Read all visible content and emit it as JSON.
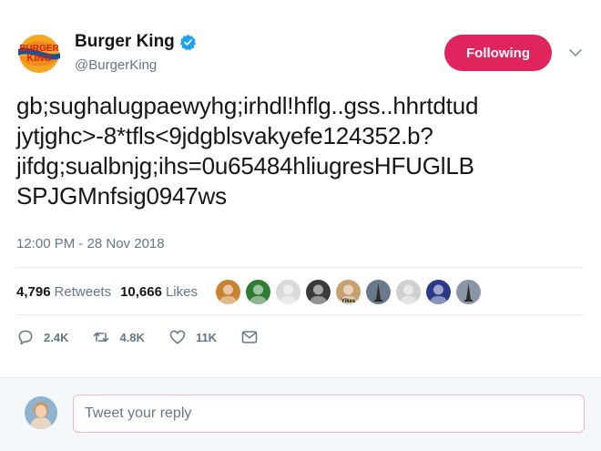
{
  "tweet": {
    "author": {
      "display_name": "Burger King",
      "handle": "@BurgerKing",
      "logo_text_top": "BURGER",
      "logo_text_bottom": "KING",
      "verified": true
    },
    "follow_button": {
      "label": "Following"
    },
    "text_lines": [
      "gb;sughalugpaewyhg;irhdl!hflg..gss..hhrtdtud",
      "jytjghc>-8*tfls<9jdgblsvakyefe124352.b?",
      "jifdg;sualbnjg;ihs=0u65484hliugresHFUGlLB",
      "SPJGMnfsig0947ws"
    ],
    "timestamp": "12:00 PM - 28 Nov 2018"
  },
  "stats": {
    "retweets_count": "4,796",
    "retweets_label": "Retweets",
    "likes_count": "10,666",
    "likes_label": "Likes",
    "likers": [
      {
        "icon": "dog-avatar-icon",
        "color": "#c9822f"
      },
      {
        "icon": "santa-hat-avatar-icon",
        "color": "#2e7d32"
      },
      {
        "icon": "dog-avatar-icon",
        "color": "#d9d9d9"
      },
      {
        "icon": "person-avatar-icon",
        "color": "#3a3a3a"
      },
      {
        "icon": "person-avatar-icon",
        "color": "#c8a070",
        "caption": "Yikes"
      },
      {
        "icon": "tower-avatar-icon",
        "color": "#6a7a8a"
      },
      {
        "icon": "person-avatar-icon",
        "color": "#d0d0d0"
      },
      {
        "icon": "person-avatar-icon",
        "color": "#2a3a8a"
      },
      {
        "icon": "tower-avatar-icon",
        "color": "#8a96a8"
      }
    ]
  },
  "actions": {
    "replies": "2.4K",
    "retweets": "4.8K",
    "likes": "11K"
  },
  "reply": {
    "placeholder": "Tweet your reply"
  },
  "colors": {
    "follow_button": "#e0245e",
    "verified_badge": "#1da1f2",
    "secondary_text": "#657786"
  }
}
